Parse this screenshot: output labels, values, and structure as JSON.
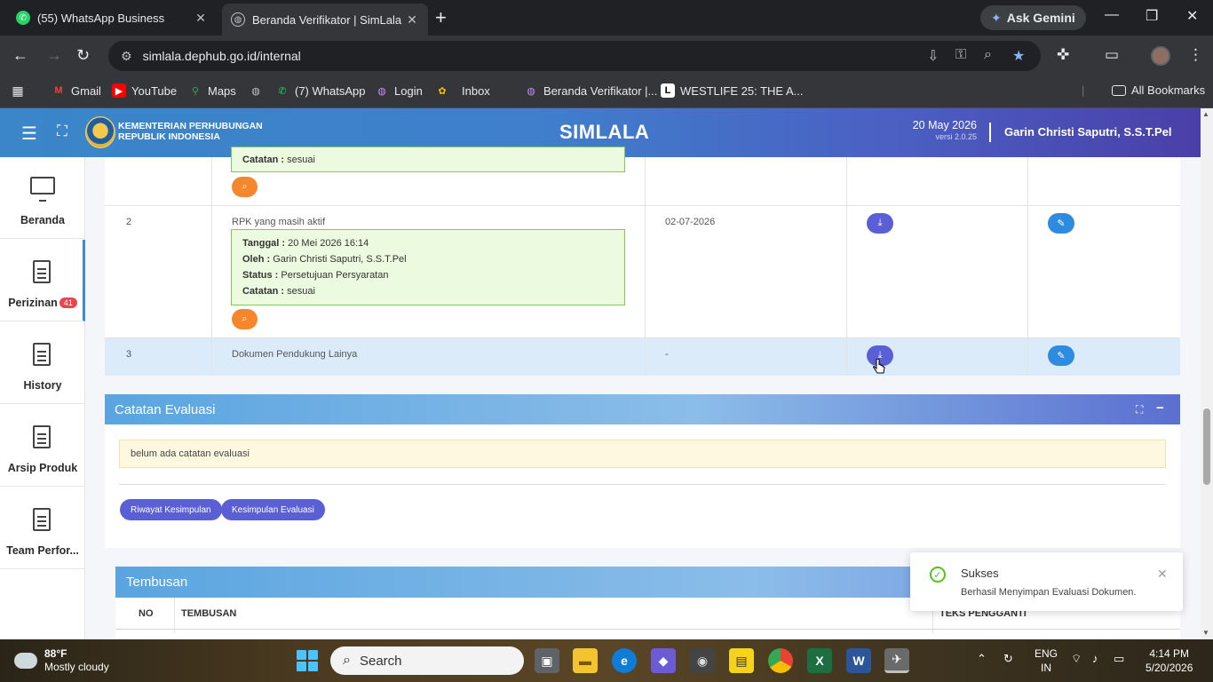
{
  "browser": {
    "tabs": [
      {
        "title": "(55) WhatsApp Business",
        "active": false
      },
      {
        "title": "Beranda Verifikator | SimLala",
        "active": true
      }
    ],
    "gemini_label": "Ask Gemini",
    "url": "simlala.dephub.go.id/internal",
    "bookmarks": [
      "Gmail",
      "YouTube",
      "Maps",
      "(7) WhatsApp",
      "Login",
      "Inbox",
      "Beranda Verifikator |...",
      "WESTLIFE 25: THE A..."
    ],
    "all_bookmarks": "All Bookmarks"
  },
  "header": {
    "org_line1": "KEMENTERIAN PERHUBUNGAN",
    "org_line2": "REPUBLIK INDONESIA",
    "brand": "SIMLALA",
    "date": "20 May 2026",
    "version": "versi 2.0.25",
    "user": "Garin Christi Saputri, S.S.T.Pel"
  },
  "sidebar": {
    "items": [
      {
        "label": "Beranda"
      },
      {
        "label": "Perizinan",
        "badge": "41"
      },
      {
        "label": "History"
      },
      {
        "label": "Arsip Produk"
      },
      {
        "label": "Team Perfor..."
      }
    ]
  },
  "table": {
    "row1": {
      "catatan_label": "Catatan :",
      "catatan_value": "sesuai"
    },
    "row2": {
      "no": "2",
      "name": "RPK yang masih aktif",
      "tanggal_label": "Tanggal :",
      "tanggal_value": "20 Mei 2026 16:14",
      "oleh_label": "Oleh :",
      "oleh_value": "Garin Christi Saputri, S.S.T.Pel",
      "status_label": "Status :",
      "status_value": "Persetujuan Persyaratan",
      "catatan_label": "Catatan :",
      "catatan_value": "sesuai",
      "date": "02-07-2026"
    },
    "row3": {
      "no": "3",
      "name": "Dokumen Pendukung Lainya",
      "date": "-"
    }
  },
  "evaluasi": {
    "title": "Catatan Evaluasi",
    "empty_note": "belum ada catatan evaluasi",
    "btn_riwayat": "Riwayat Kesimpulan",
    "btn_kesimpulan": "Kesimpulan Evaluasi"
  },
  "tembusan": {
    "title": "Tembusan",
    "col_no": "NO",
    "col_tembusan": "TEMBUSAN",
    "col_teks": "TEKS PENGGANTI"
  },
  "toast": {
    "title": "Sukses",
    "message": "Berhasil Menyimpan Evaluasi Dokumen."
  },
  "taskbar": {
    "temp": "88°F",
    "weather": "Mostly cloudy",
    "search_placeholder": "Search",
    "lang1": "ENG",
    "lang2": "IN",
    "time": "4:14 PM",
    "date": "5/20/2026"
  }
}
